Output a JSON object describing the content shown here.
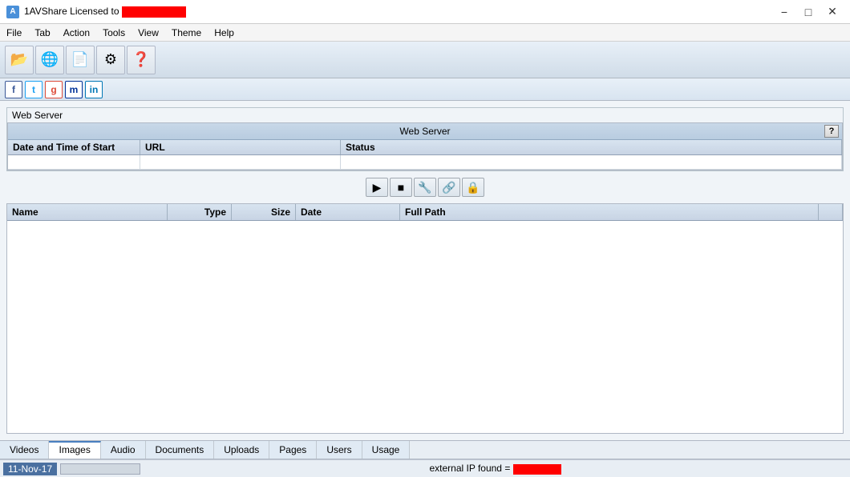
{
  "titlebar": {
    "app_name": "1AVShare Licensed to ",
    "redacted": true,
    "minimize_label": "−",
    "maximize_label": "□",
    "close_label": "✕"
  },
  "menubar": {
    "items": [
      "File",
      "Tab",
      "Action",
      "Tools",
      "View",
      "Theme",
      "Help"
    ]
  },
  "toolbar": {
    "buttons": [
      {
        "name": "folder-open-icon",
        "symbol": "📂"
      },
      {
        "name": "globe-icon",
        "symbol": "🌐"
      },
      {
        "name": "document-icon",
        "symbol": "📄"
      },
      {
        "name": "gear-icon",
        "symbol": "⚙"
      },
      {
        "name": "help-icon",
        "symbol": "❓"
      }
    ]
  },
  "social": {
    "buttons": [
      {
        "name": "facebook-btn",
        "label": "f",
        "color": "#3b5998"
      },
      {
        "name": "twitter-btn",
        "label": "t",
        "color": "#1da1f2"
      },
      {
        "name": "google-btn",
        "label": "g",
        "color": "#dd4b39"
      },
      {
        "name": "myspace-btn",
        "label": "m",
        "color": "#003399"
      },
      {
        "name": "linkedin-btn",
        "label": "in",
        "color": "#0077b5"
      }
    ]
  },
  "web_server_section": {
    "section_label": "Web Server",
    "panel_title": "Web Server",
    "help_label": "?",
    "columns": [
      {
        "key": "date",
        "label": "Date and Time of Start"
      },
      {
        "key": "url",
        "label": "URL"
      },
      {
        "key": "status",
        "label": "Status"
      }
    ],
    "rows": []
  },
  "mid_toolbar": {
    "buttons": [
      {
        "name": "play-btn",
        "symbol": "▶"
      },
      {
        "name": "stop-btn",
        "symbol": "■"
      },
      {
        "name": "settings-btn",
        "symbol": "🔧"
      },
      {
        "name": "link-btn",
        "symbol": "🔗"
      },
      {
        "name": "lock-btn",
        "symbol": "🔒"
      }
    ]
  },
  "files_table": {
    "columns": [
      {
        "key": "name",
        "label": "Name"
      },
      {
        "key": "type",
        "label": "Type"
      },
      {
        "key": "size",
        "label": "Size"
      },
      {
        "key": "date",
        "label": "Date"
      },
      {
        "key": "fullpath",
        "label": "Full Path"
      },
      {
        "key": "extra",
        "label": ""
      }
    ],
    "rows": []
  },
  "tabs": [
    {
      "key": "videos",
      "label": "Videos",
      "active": false
    },
    {
      "key": "images",
      "label": "Images",
      "active": true
    },
    {
      "key": "audio",
      "label": "Audio",
      "active": false
    },
    {
      "key": "documents",
      "label": "Documents",
      "active": false
    },
    {
      "key": "uploads",
      "label": "Uploads",
      "active": false
    },
    {
      "key": "pages",
      "label": "Pages",
      "active": false
    },
    {
      "key": "users",
      "label": "Users",
      "active": false
    },
    {
      "key": "usage",
      "label": "Usage",
      "active": false
    }
  ],
  "statusbar": {
    "date": "11-Nov-17",
    "ip_text": "external IP found = ",
    "ip_redacted": true
  }
}
